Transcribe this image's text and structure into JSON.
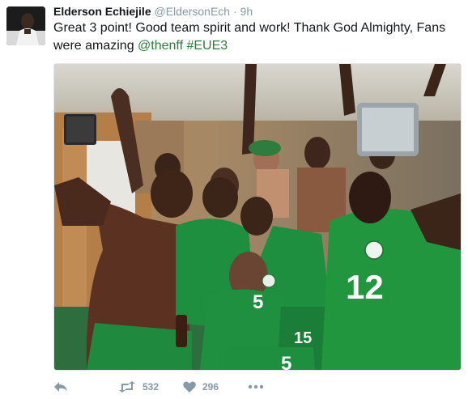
{
  "tweet": {
    "author_name": "Elderson Echiejile",
    "author_handle": "@EldersonEch",
    "separator": "·",
    "time": "9h",
    "text_main": "Great 3 point! Good team spirit and work! Thank God Almighty, Fans were amazing ",
    "mention": "@thenff",
    "hashtag": "#EUE3"
  },
  "media": {
    "jersey_numbers": [
      "5",
      "12",
      "15",
      "5"
    ]
  },
  "actions": {
    "reply_icon": "reply-icon",
    "retweet_icon": "retweet-icon",
    "retweet_count": "532",
    "like_icon": "heart-icon",
    "like_count": "296",
    "more_icon": "more-icon"
  },
  "colors": {
    "link": "#2a7d3a",
    "muted": "#8899a6",
    "jersey_green": "#1e8f3e"
  }
}
